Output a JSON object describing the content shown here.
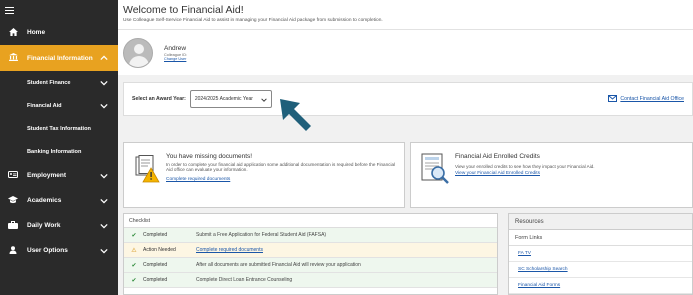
{
  "nav": {
    "items": [
      {
        "label": "Home",
        "icon": "home-icon"
      },
      {
        "label": "Financial Information",
        "icon": "bank-icon"
      },
      {
        "label": "Employment",
        "icon": "id-card-icon"
      },
      {
        "label": "Academics",
        "icon": "graduation-cap-icon"
      },
      {
        "label": "Daily Work",
        "icon": "briefcase-icon"
      },
      {
        "label": "User Options",
        "icon": "user-icon"
      }
    ],
    "sub_items": [
      {
        "label": "Student Finance"
      },
      {
        "label": "Financial Aid"
      },
      {
        "label": "Student Tax Information"
      },
      {
        "label": "Banking Information"
      }
    ],
    "active_color": "#e8a220"
  },
  "header": {
    "title": "Welcome to Financial Aid!",
    "subtitle": "Use Colleague Self-Service Financial Aid to assist in managing your Financial Aid package from submission to completion."
  },
  "user": {
    "name": "Andrew",
    "id_label": "Colleague ID:",
    "change_user": "Change User"
  },
  "award": {
    "label": "Select an Award Year:",
    "selected": "2024/2025 Academic Year",
    "contact": "Contact Financial Aid Office"
  },
  "missing_docs": {
    "title": "You have missing documents!",
    "text": "In order to complete your financial aid application some additional documentation is required before the Financial Aid office can evaluate your information.",
    "link": "Complete required documents"
  },
  "credits": {
    "title": "Financial Aid Enrolled Credits",
    "text": "View your enrolled credits to see how they impact your Financial Aid.",
    "link": "View your Financial Aid Enrolled Credits"
  },
  "checklist": {
    "heading": "Checklist",
    "rows": [
      {
        "status": "Completed",
        "desc": "Submit a Free Application for Federal Student Aid (FAFSA)"
      },
      {
        "status": "Action Needed",
        "desc": "Complete required documents"
      },
      {
        "status": "Completed",
        "desc": "After all documents are submitted Financial Aid will review your application"
      },
      {
        "status": "Completed",
        "desc": "Complete Direct Loan Entrance Counseling"
      }
    ]
  },
  "resources": {
    "heading": "Resources",
    "subheading": "Form Links",
    "links": [
      "FA TV",
      "SC Scholarship Search",
      "Financial Aid Forms"
    ]
  }
}
